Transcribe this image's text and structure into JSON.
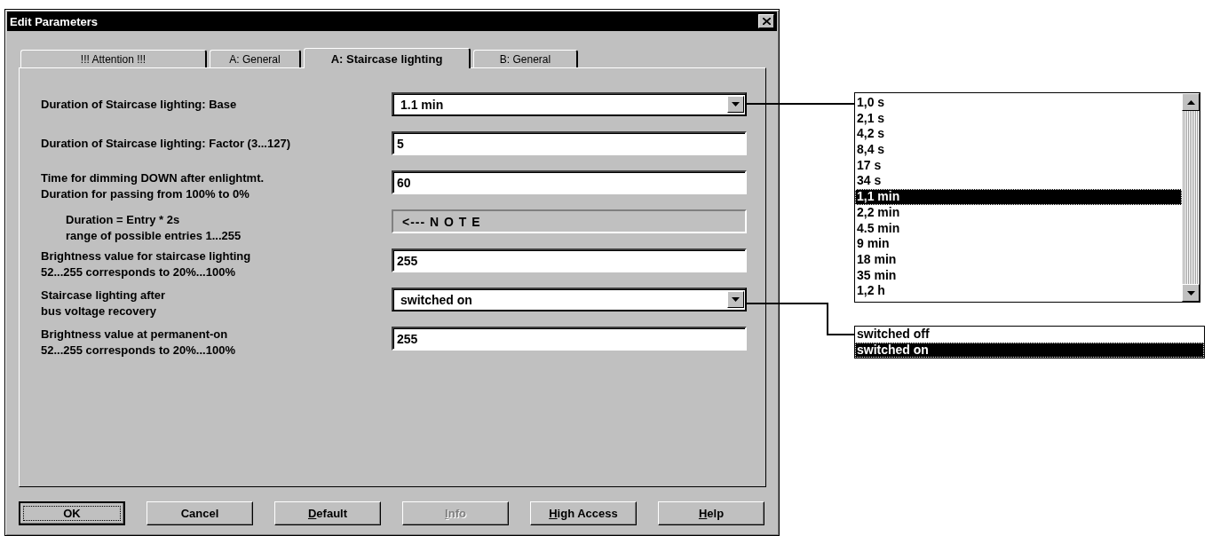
{
  "window": {
    "title": "Edit Parameters"
  },
  "tabs": [
    {
      "label": "!!! Attention !!!",
      "selected": false
    },
    {
      "label": "A: General",
      "selected": false
    },
    {
      "label": "A: Staircase lighting",
      "selected": true
    },
    {
      "label": "B: General",
      "selected": false
    }
  ],
  "parameters": [
    {
      "kind": "dropdown",
      "label": [
        "Duration of Staircase lighting: Base"
      ],
      "value": "1.1 min"
    },
    {
      "kind": "text",
      "label": [
        "Duration of Staircase lighting: Factor (3...127)"
      ],
      "value": "5"
    },
    {
      "kind": "text",
      "label": [
        "Time for dimming DOWN after enlightmt.",
        "Duration for passing from 100% to 0%"
      ],
      "value": "60"
    },
    {
      "kind": "note",
      "label": [
        "Duration = Entry * 2s",
        "range of possible entries 1...255"
      ],
      "value": "<--- N O T E"
    },
    {
      "kind": "text",
      "label": [
        "Brightness value for staircase lighting",
        "52...255 corresponds to 20%...100%"
      ],
      "value": "255"
    },
    {
      "kind": "dropdown",
      "label": [
        "Staircase lighting after",
        "bus voltage recovery"
      ],
      "value": "switched on"
    },
    {
      "kind": "text",
      "label": [
        "Brightness value at permanent-on",
        "52...255 corresponds to 20%...100%"
      ],
      "value": "255"
    }
  ],
  "buttons": [
    {
      "label": "OK",
      "default": true,
      "disabled": false,
      "underline_first": false
    },
    {
      "label": "Cancel",
      "default": false,
      "disabled": false,
      "underline_first": false
    },
    {
      "label": "Default",
      "default": false,
      "disabled": false,
      "underline_first": true
    },
    {
      "label": "Info",
      "default": false,
      "disabled": true,
      "underline_first": true
    },
    {
      "label": "High Access",
      "default": false,
      "disabled": false,
      "underline_first": true
    },
    {
      "label": "Help",
      "default": false,
      "disabled": false,
      "underline_first": true
    }
  ],
  "base_options": [
    {
      "label": "1,0 s",
      "selected": false
    },
    {
      "label": "2,1 s",
      "selected": false
    },
    {
      "label": "4,2 s",
      "selected": false
    },
    {
      "label": "8,4 s",
      "selected": false
    },
    {
      "label": "17 s",
      "selected": false
    },
    {
      "label": "34 s",
      "selected": false
    },
    {
      "label": "1,1 min",
      "selected": true
    },
    {
      "label": "2,2 min",
      "selected": false
    },
    {
      "label": "4.5 min",
      "selected": false
    },
    {
      "label": "9 min",
      "selected": false
    },
    {
      "label": "18 min",
      "selected": false
    },
    {
      "label": "35 min",
      "selected": false
    },
    {
      "label": "1,2 h",
      "selected": false
    }
  ],
  "recovery_options": [
    {
      "label": "switched off",
      "selected": false
    },
    {
      "label": "switched on",
      "selected": true
    }
  ]
}
